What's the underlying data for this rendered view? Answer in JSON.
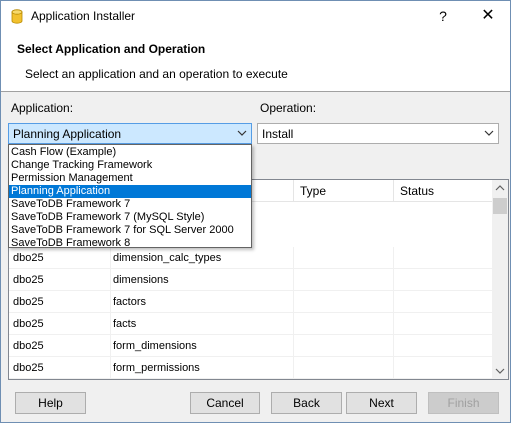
{
  "window": {
    "title": "Application Installer",
    "help_glyph": "?",
    "close_glyph": "✕"
  },
  "header": {
    "title": "Select Application and Operation",
    "subtitle": "Select an application and an operation to execute"
  },
  "application": {
    "label": "Application:",
    "selected": "Planning Application",
    "options": [
      "Cash Flow (Example)",
      "Change Tracking Framework",
      "Permission Management",
      "Planning Application",
      "SaveToDB Framework 7",
      "SaveToDB Framework 7 (MySQL Style)",
      "SaveToDB Framework 7 for SQL Server 2000",
      "SaveToDB Framework 8"
    ],
    "selected_index": 3
  },
  "operation": {
    "label": "Operation:",
    "selected": "Install"
  },
  "grid": {
    "columns": [
      "",
      "",
      "Type",
      "Status"
    ],
    "rows": [
      [
        "dbo25",
        "dimension_calc_types",
        "",
        ""
      ],
      [
        "dbo25",
        "dimensions",
        "",
        ""
      ],
      [
        "dbo25",
        "factors",
        "",
        ""
      ],
      [
        "dbo25",
        "facts",
        "",
        ""
      ],
      [
        "dbo25",
        "form_dimensions",
        "",
        ""
      ],
      [
        "dbo25",
        "form_permissions",
        "",
        ""
      ]
    ]
  },
  "buttons": {
    "help": "Help",
    "cancel": "Cancel",
    "back": "Back",
    "next": "Next",
    "finish": "Finish"
  },
  "colors": {
    "selection": "#0078d7",
    "combo_focus": "#cce8ff",
    "accent_border": "#569de5"
  }
}
